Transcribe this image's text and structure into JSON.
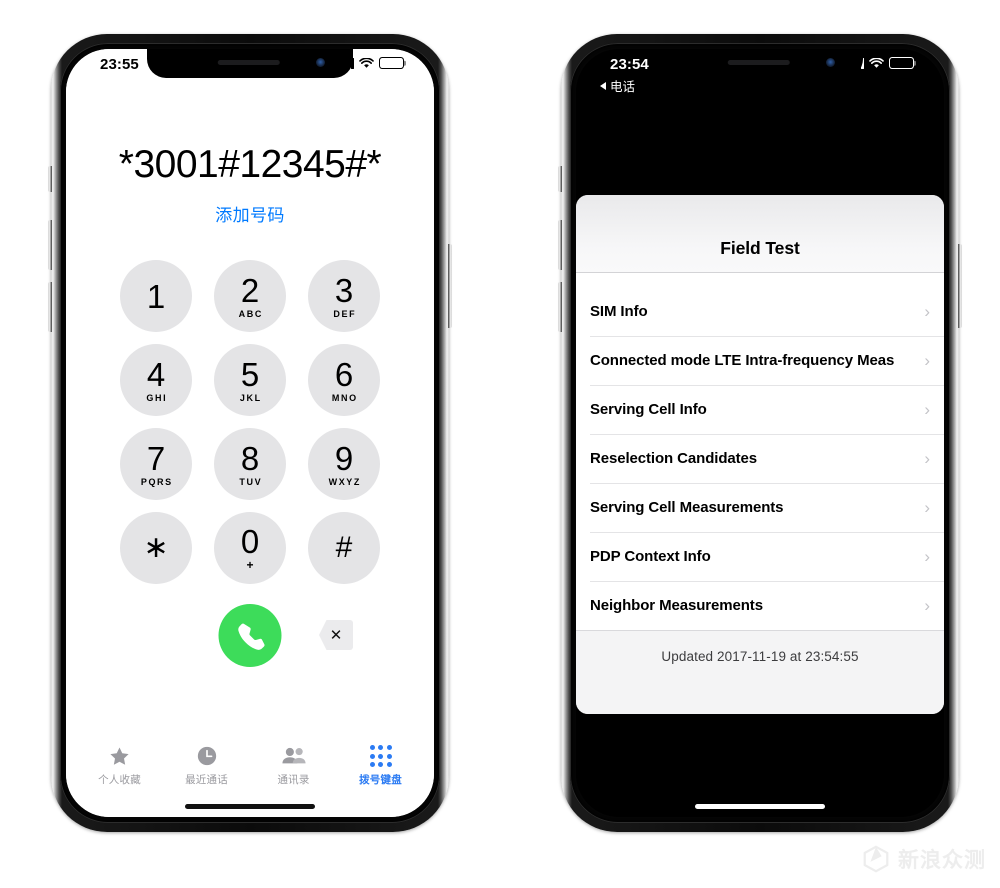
{
  "watermark": {
    "text": "新浪众测",
    "logo_icon": "cube-logo-icon",
    "color": "#ececec"
  },
  "left_phone": {
    "status_bar": {
      "time": "23:55",
      "signal_icon": "cellular-signal-icon",
      "wifi_icon": "wifi-icon",
      "battery_icon": "battery-full-icon"
    },
    "dialer": {
      "number": "*3001#12345#*",
      "add_number_label": "添加号码",
      "add_number_color": "#007aff",
      "keys": [
        {
          "digit": "1",
          "letters": ""
        },
        {
          "digit": "2",
          "letters": "ABC"
        },
        {
          "digit": "3",
          "letters": "DEF"
        },
        {
          "digit": "4",
          "letters": "GHI"
        },
        {
          "digit": "5",
          "letters": "JKL"
        },
        {
          "digit": "6",
          "letters": "MNO"
        },
        {
          "digit": "7",
          "letters": "PQRS"
        },
        {
          "digit": "8",
          "letters": "TUV"
        },
        {
          "digit": "9",
          "letters": "WXYZ"
        },
        {
          "digit": "∗",
          "letters": ""
        },
        {
          "digit": "0",
          "letters": "+"
        },
        {
          "digit": "#",
          "letters": ""
        }
      ],
      "call_button_icon": "phone-handset-icon",
      "call_button_color": "#3ddc5a",
      "delete_button_icon": "backspace-delete-icon",
      "delete_button_glyph": "✕"
    },
    "tabs": [
      {
        "label": "个人收藏",
        "icon": "star-icon",
        "active": false
      },
      {
        "label": "最近通话",
        "icon": "clock-icon",
        "active": false
      },
      {
        "label": "通讯录",
        "icon": "contacts-people-icon",
        "active": false
      },
      {
        "label": "拨号键盘",
        "icon": "keypad-dots-icon",
        "active": true
      }
    ],
    "active_tab_color": "#2b7bf3"
  },
  "right_phone": {
    "status_bar": {
      "time": "23:54",
      "signal_icon": "cellular-signal-icon",
      "wifi_icon": "wifi-icon",
      "battery_icon": "battery-full-icon"
    },
    "back_link": {
      "label": "电话",
      "icon": "back-triangle-icon"
    },
    "field_test": {
      "title": "Field Test",
      "rows": [
        {
          "label": "SIM Info",
          "chevron": "›"
        },
        {
          "label": "Connected mode LTE Intra-frequency Meas",
          "chevron": "›"
        },
        {
          "label": "Serving Cell Info",
          "chevron": "›"
        },
        {
          "label": "Reselection Candidates",
          "chevron": "›"
        },
        {
          "label": "Serving Cell Measurements",
          "chevron": "›"
        },
        {
          "label": "PDP Context Info",
          "chevron": "›"
        },
        {
          "label": "Neighbor Measurements",
          "chevron": "›"
        }
      ],
      "updated_text": "Updated 2017-11-19 at 23:54:55"
    }
  }
}
